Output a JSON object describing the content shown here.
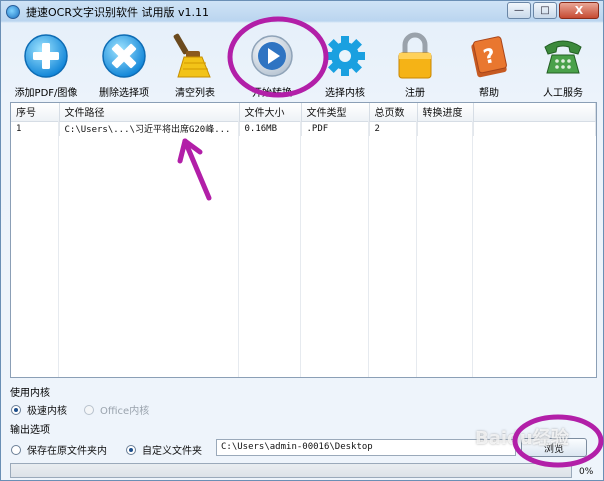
{
  "window": {
    "title": "捷速OCR文字识别软件 试用版 v1.11",
    "controls": {
      "minimize": "—",
      "maximize": "□",
      "close": "X"
    }
  },
  "toolbar": {
    "items": [
      {
        "label": "添加PDF/图像",
        "icon": "add-icon"
      },
      {
        "label": "删除选择项",
        "icon": "delete-icon"
      },
      {
        "label": "清空列表",
        "icon": "broom-icon"
      },
      {
        "label": "开始转换",
        "icon": "play-icon"
      },
      {
        "label": "选择内核",
        "icon": "gear-icon"
      },
      {
        "label": "注册",
        "icon": "lock-icon"
      },
      {
        "label": "帮助",
        "icon": "help-book-icon"
      },
      {
        "label": "人工服务",
        "icon": "phone-icon"
      }
    ]
  },
  "table": {
    "columns": [
      "序号",
      "文件路径",
      "文件大小",
      "文件类型",
      "总页数",
      "转换进度"
    ],
    "rows": [
      [
        "1",
        "C:\\Users\\...\\习近平将出席G20峰...",
        "0.16MB",
        ".PDF",
        "2",
        ""
      ]
    ]
  },
  "kernel": {
    "section_label": "使用内核",
    "options": [
      {
        "label": "极速内核",
        "selected": true,
        "enabled": true
      },
      {
        "label": "Office内核",
        "selected": false,
        "enabled": false
      }
    ]
  },
  "output": {
    "section_label": "输出选项",
    "options": [
      {
        "label": "保存在原文件夹内",
        "selected": false
      },
      {
        "label": "自定义文件夹",
        "selected": true
      }
    ],
    "path": "C:\\Users\\admin-00016\\Desktop",
    "browse_label": "浏览"
  },
  "progress": {
    "value": 0,
    "label": "0%"
  },
  "watermark": "Baidu经验",
  "colors": {
    "annotation": "#b21fa8",
    "progress_fill": "#5fb04e",
    "window_border": "#6a8fb5"
  }
}
